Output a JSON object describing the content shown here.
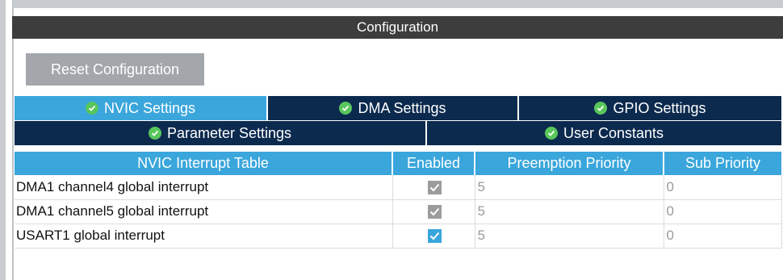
{
  "panel": {
    "title": "Configuration"
  },
  "toolbar": {
    "reset_label": "Reset Configuration"
  },
  "tabs_row1": [
    {
      "label": "NVIC Settings",
      "active": true
    },
    {
      "label": "DMA Settings",
      "active": false
    },
    {
      "label": "GPIO Settings",
      "active": false
    }
  ],
  "tabs_row2": [
    {
      "label": "Parameter Settings",
      "active": false
    },
    {
      "label": "User Constants",
      "active": false
    }
  ],
  "table": {
    "headers": [
      "NVIC Interrupt Table",
      "Enabled",
      "Preemption Priority",
      "Sub Priority"
    ],
    "rows": [
      {
        "name": "DMA1 channel4 global interrupt",
        "enabled": true,
        "editable": false,
        "preemption": "5",
        "sub": "0"
      },
      {
        "name": "DMA1 channel5 global interrupt",
        "enabled": true,
        "editable": false,
        "preemption": "5",
        "sub": "0"
      },
      {
        "name": "USART1 global interrupt",
        "enabled": true,
        "editable": true,
        "preemption": "5",
        "sub": "0"
      }
    ]
  },
  "colors": {
    "accent": "#3aa6dc",
    "tab_dark": "#0c2a4e",
    "header_dark": "#3d3d3d",
    "check_green": "#59c65c"
  },
  "icons": {
    "tab_status": "check-circle-icon",
    "checkbox": "checkbox-icon"
  }
}
